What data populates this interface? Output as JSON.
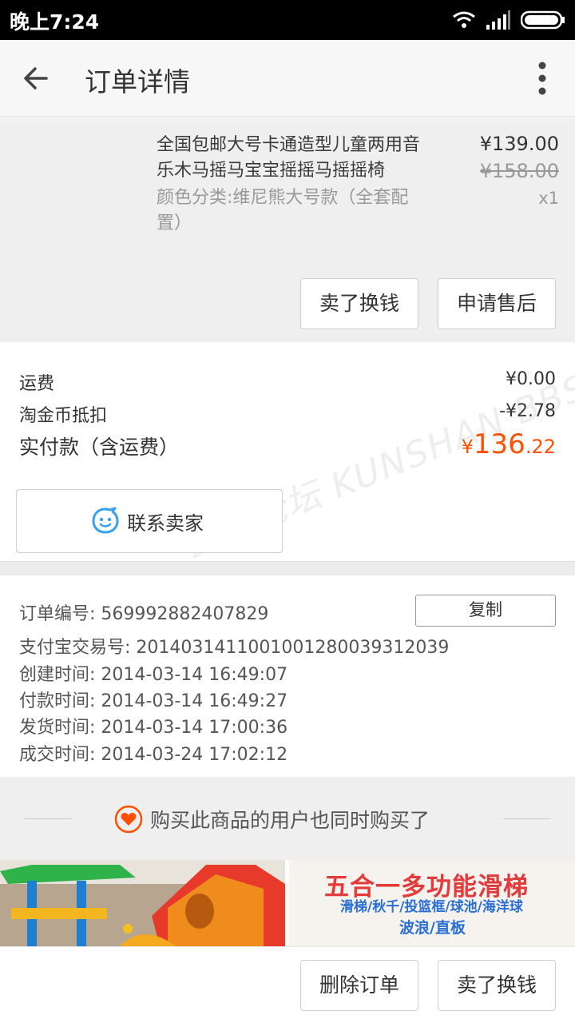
{
  "status_bar": {
    "time": "晚上7:24",
    "icons": [
      "wifi-icon",
      "signal-icon",
      "battery-icon"
    ]
  },
  "app_bar": {
    "title": "订单详情"
  },
  "product": {
    "name": "全国包邮大号卡通造型儿童两用音乐木马摇马宝宝摇摇马摇摇椅",
    "variant": "颜色分类:维尼熊大号款（全套配置）",
    "price_now": "¥139.00",
    "price_old": "¥158.00",
    "quantity": "x1",
    "sell_label": "卖了换钱",
    "aftersale_label": "申请售后"
  },
  "summary": {
    "freight_label": "运费",
    "freight_value": "¥0.00",
    "coin_label": "淘金币抵扣",
    "coin_value": "-¥2.78",
    "paid_label": "实付款（含运费）",
    "paid_currency": "¥",
    "paid_integer": "136",
    "paid_decimal": ".22",
    "contact_label": "联系卖家",
    "watermark": "昆山论坛 KUNSHAN BBS"
  },
  "order_info": {
    "order_no_label": "订单编号:",
    "order_no": "569992882407829",
    "copy_label": "复制",
    "alipay_label": "支付宝交易号:",
    "alipay_no": "2014031411001001280039312039",
    "created_label": "创建时间:",
    "created": "2014-03-14 16:49:07",
    "paid_time_label": "付款时间:",
    "paid_time": "2014-03-14 16:49:27",
    "shipped_label": "发货时间:",
    "shipped": "2014-03-14 17:00:36",
    "closed_label": "成交时间:",
    "closed": "2014-03-24 17:02:12"
  },
  "recommend": {
    "title": "购买此商品的用户也同时购买了",
    "item2_title": "五合一多功能滑梯",
    "item2_sub1": "滑梯/秋千/投篮框/球池/海洋球",
    "item2_sub2": "波浪/直板"
  },
  "bottom_bar": {
    "delete_label": "删除订单",
    "sell_label": "卖了换钱"
  },
  "colors": {
    "accent": "#ff5000",
    "heart": "#ff5000",
    "contact_icon": "#3aa0f0"
  }
}
